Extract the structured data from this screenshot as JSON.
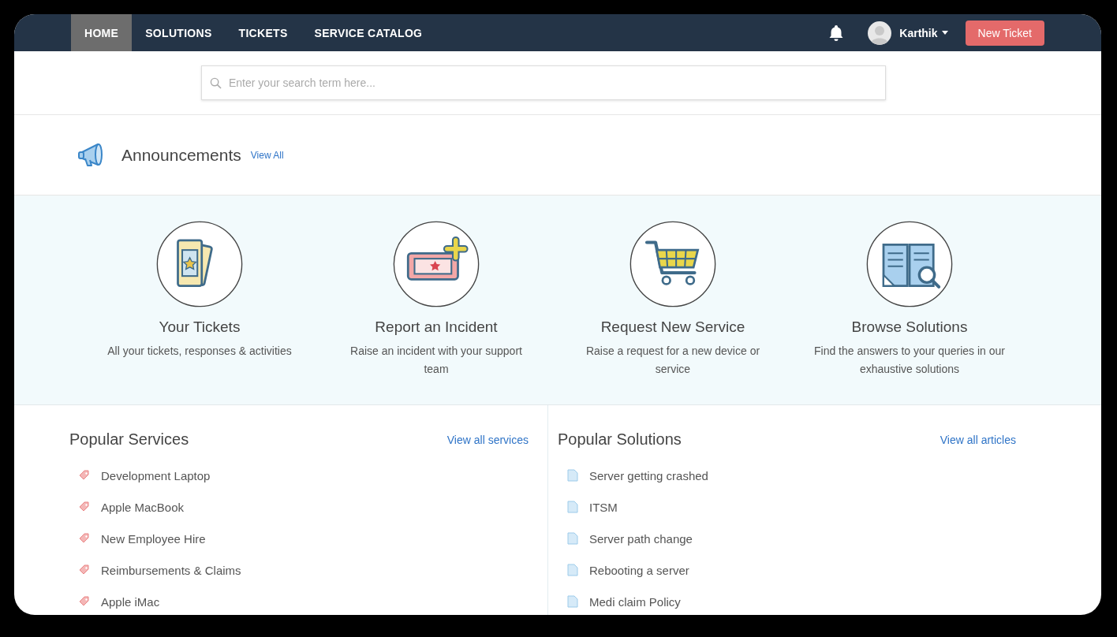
{
  "nav": {
    "tabs": [
      {
        "label": "HOME",
        "selected": true
      },
      {
        "label": "SOLUTIONS",
        "selected": false
      },
      {
        "label": "TICKETS",
        "selected": false
      },
      {
        "label": "SERVICE CATALOG",
        "selected": false
      }
    ],
    "user": "Karthik",
    "new_ticket": "New Ticket"
  },
  "search": {
    "placeholder": "Enter your search term here..."
  },
  "announcements": {
    "title": "Announcements",
    "link": "View All"
  },
  "cards": [
    {
      "kind": "tickets",
      "title": "Your Tickets",
      "text": "All your tickets, responses & activities"
    },
    {
      "kind": "incident",
      "title": "Report an Incident",
      "text": "Raise an incident with your support team"
    },
    {
      "kind": "cart",
      "title": "Request New Service",
      "text": "Raise a request for a new device or service"
    },
    {
      "kind": "book",
      "title": "Browse Solutions",
      "text": "Find the answers to your queries in our exhaustive solutions"
    }
  ],
  "popular_services": {
    "title": "Popular Services",
    "link": "View all services",
    "items": [
      "Development Laptop",
      "Apple MacBook",
      "New Employee Hire",
      "Reimbursements & Claims",
      "Apple iMac"
    ]
  },
  "popular_solutions": {
    "title": "Popular Solutions",
    "link": "View all articles",
    "items": [
      "Server getting crashed",
      "ITSM",
      "Server path change",
      "Rebooting a server",
      "Medi claim Policy"
    ]
  }
}
